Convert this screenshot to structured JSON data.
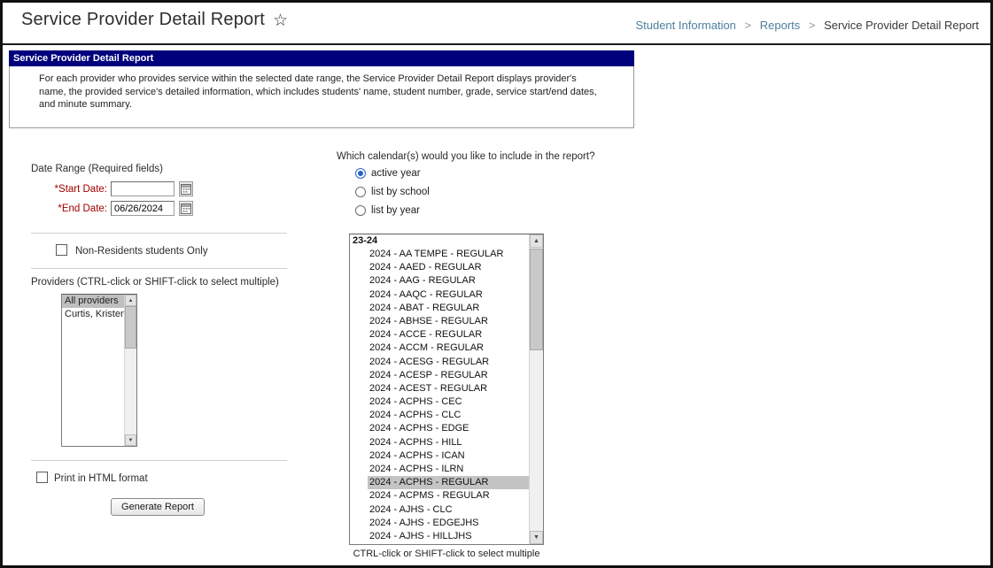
{
  "header": {
    "title": "Service Provider Detail Report"
  },
  "breadcrumb": {
    "separator": ">",
    "items": [
      "Student Information",
      "Reports",
      "Service Provider Detail Report"
    ]
  },
  "report": {
    "section_title": "Service Provider Detail Report",
    "description": "For each provider who provides service within the selected date range, the Service Provider Detail Report displays provider's name, the provided service's detailed information, which includes students' name, student number, grade, service start/end dates, and minute summary."
  },
  "date_range": {
    "heading": "Date Range (Required fields)",
    "start_label": "*Start Date:",
    "start_value": "",
    "end_label": "*End Date:",
    "end_value": "06/26/2024"
  },
  "non_residents": {
    "label": "Non-Residents students Only",
    "checked": false
  },
  "providers": {
    "heading": "Providers (CTRL-click or SHIFT-click to select multiple)",
    "items": [
      {
        "label": "All providers",
        "selected": true
      },
      {
        "label": "Curtis, Kristen",
        "selected": false
      }
    ]
  },
  "print_html": {
    "label": "Print in HTML format",
    "checked": false
  },
  "generate_button": "Generate Report",
  "calendars": {
    "question": "Which calendar(s) would you like to include in the report?",
    "options": [
      {
        "label": "active year",
        "selected": true
      },
      {
        "label": "list by school",
        "selected": false
      },
      {
        "label": "list by year",
        "selected": false
      }
    ],
    "group_label": "23-24",
    "items": [
      {
        "label": "2024 - AA TEMPE - REGULAR",
        "selected": false
      },
      {
        "label": "2024 - AAED - REGULAR",
        "selected": false
      },
      {
        "label": "2024 - AAG - REGULAR",
        "selected": false
      },
      {
        "label": "2024 - AAQC - REGULAR",
        "selected": false
      },
      {
        "label": "2024 - ABAT - REGULAR",
        "selected": false
      },
      {
        "label": "2024 - ABHSE - REGULAR",
        "selected": false
      },
      {
        "label": "2024 - ACCE - REGULAR",
        "selected": false
      },
      {
        "label": "2024 - ACCM - REGULAR",
        "selected": false
      },
      {
        "label": "2024 - ACESG - REGULAR",
        "selected": false
      },
      {
        "label": "2024 - ACESP - REGULAR",
        "selected": false
      },
      {
        "label": "2024 - ACEST - REGULAR",
        "selected": false
      },
      {
        "label": "2024 - ACPHS - CEC",
        "selected": false
      },
      {
        "label": "2024 - ACPHS - CLC",
        "selected": false
      },
      {
        "label": "2024 - ACPHS - EDGE",
        "selected": false
      },
      {
        "label": "2024 - ACPHS - HILL",
        "selected": false
      },
      {
        "label": "2024 - ACPHS - ICAN",
        "selected": false
      },
      {
        "label": "2024 - ACPHS - ILRN",
        "selected": false
      },
      {
        "label": "2024 - ACPHS - REGULAR",
        "selected": true
      },
      {
        "label": "2024 - ACPMS - REGULAR",
        "selected": false
      },
      {
        "label": "2024 - AJHS - CLC",
        "selected": false
      },
      {
        "label": "2024 - AJHS - EDGEJHS",
        "selected": false
      },
      {
        "label": "2024 - AJHS - HILLJHS",
        "selected": false
      }
    ],
    "hint": "CTRL-click or SHIFT-click to select multiple"
  },
  "colors": {
    "section_header_bg": "#00007c",
    "selection_gray": "#c4c4c4",
    "breadcrumb_link": "#4d7f9d",
    "required_label": "#a30000",
    "radio_selected": "#2464c6"
  }
}
